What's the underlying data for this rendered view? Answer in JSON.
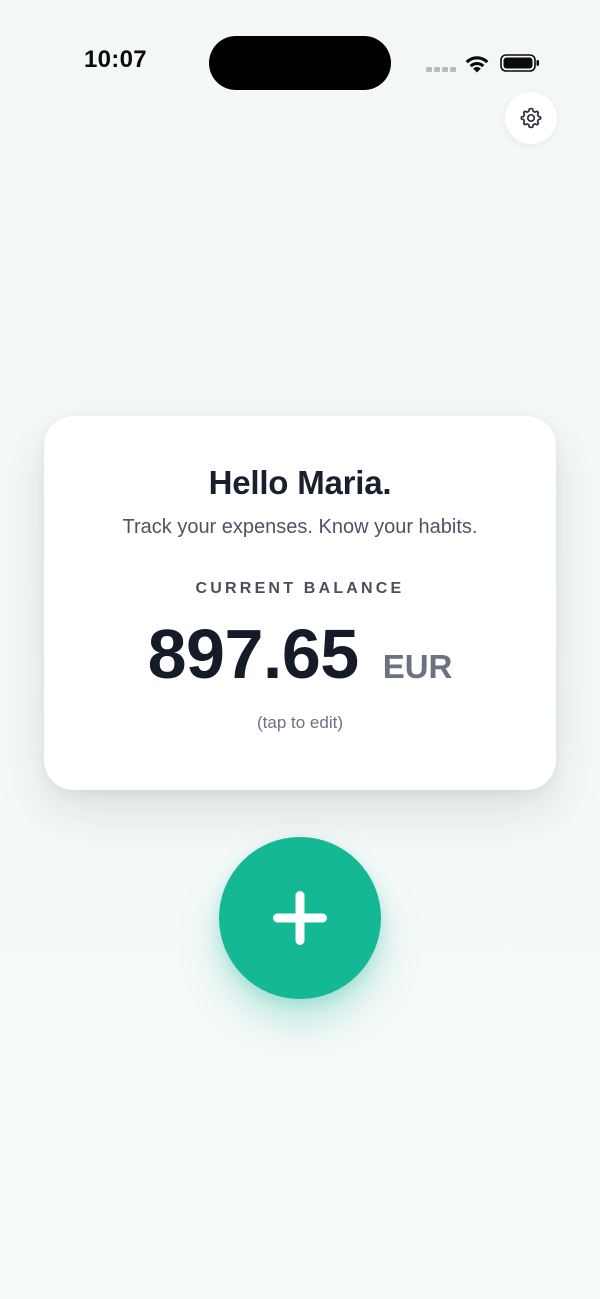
{
  "status_bar": {
    "time": "10:07"
  },
  "icons": {
    "settings": "gear-icon",
    "add": "plus-icon",
    "wifi": "wifi-icon",
    "battery": "battery-icon",
    "signal": "cellular-signal-icon"
  },
  "card": {
    "greeting": "Hello Maria.",
    "tagline": "Track your expenses. Know your habits.",
    "balance_label": "CURRENT BALANCE",
    "balance_amount": "897.65",
    "currency": "EUR",
    "edit_hint": "(tap to edit)"
  },
  "colors": {
    "accent": "#14b894",
    "background": "#f4f8f7",
    "card": "#ffffff",
    "text_primary": "#1a1f2e",
    "text_secondary": "#6b7280"
  }
}
